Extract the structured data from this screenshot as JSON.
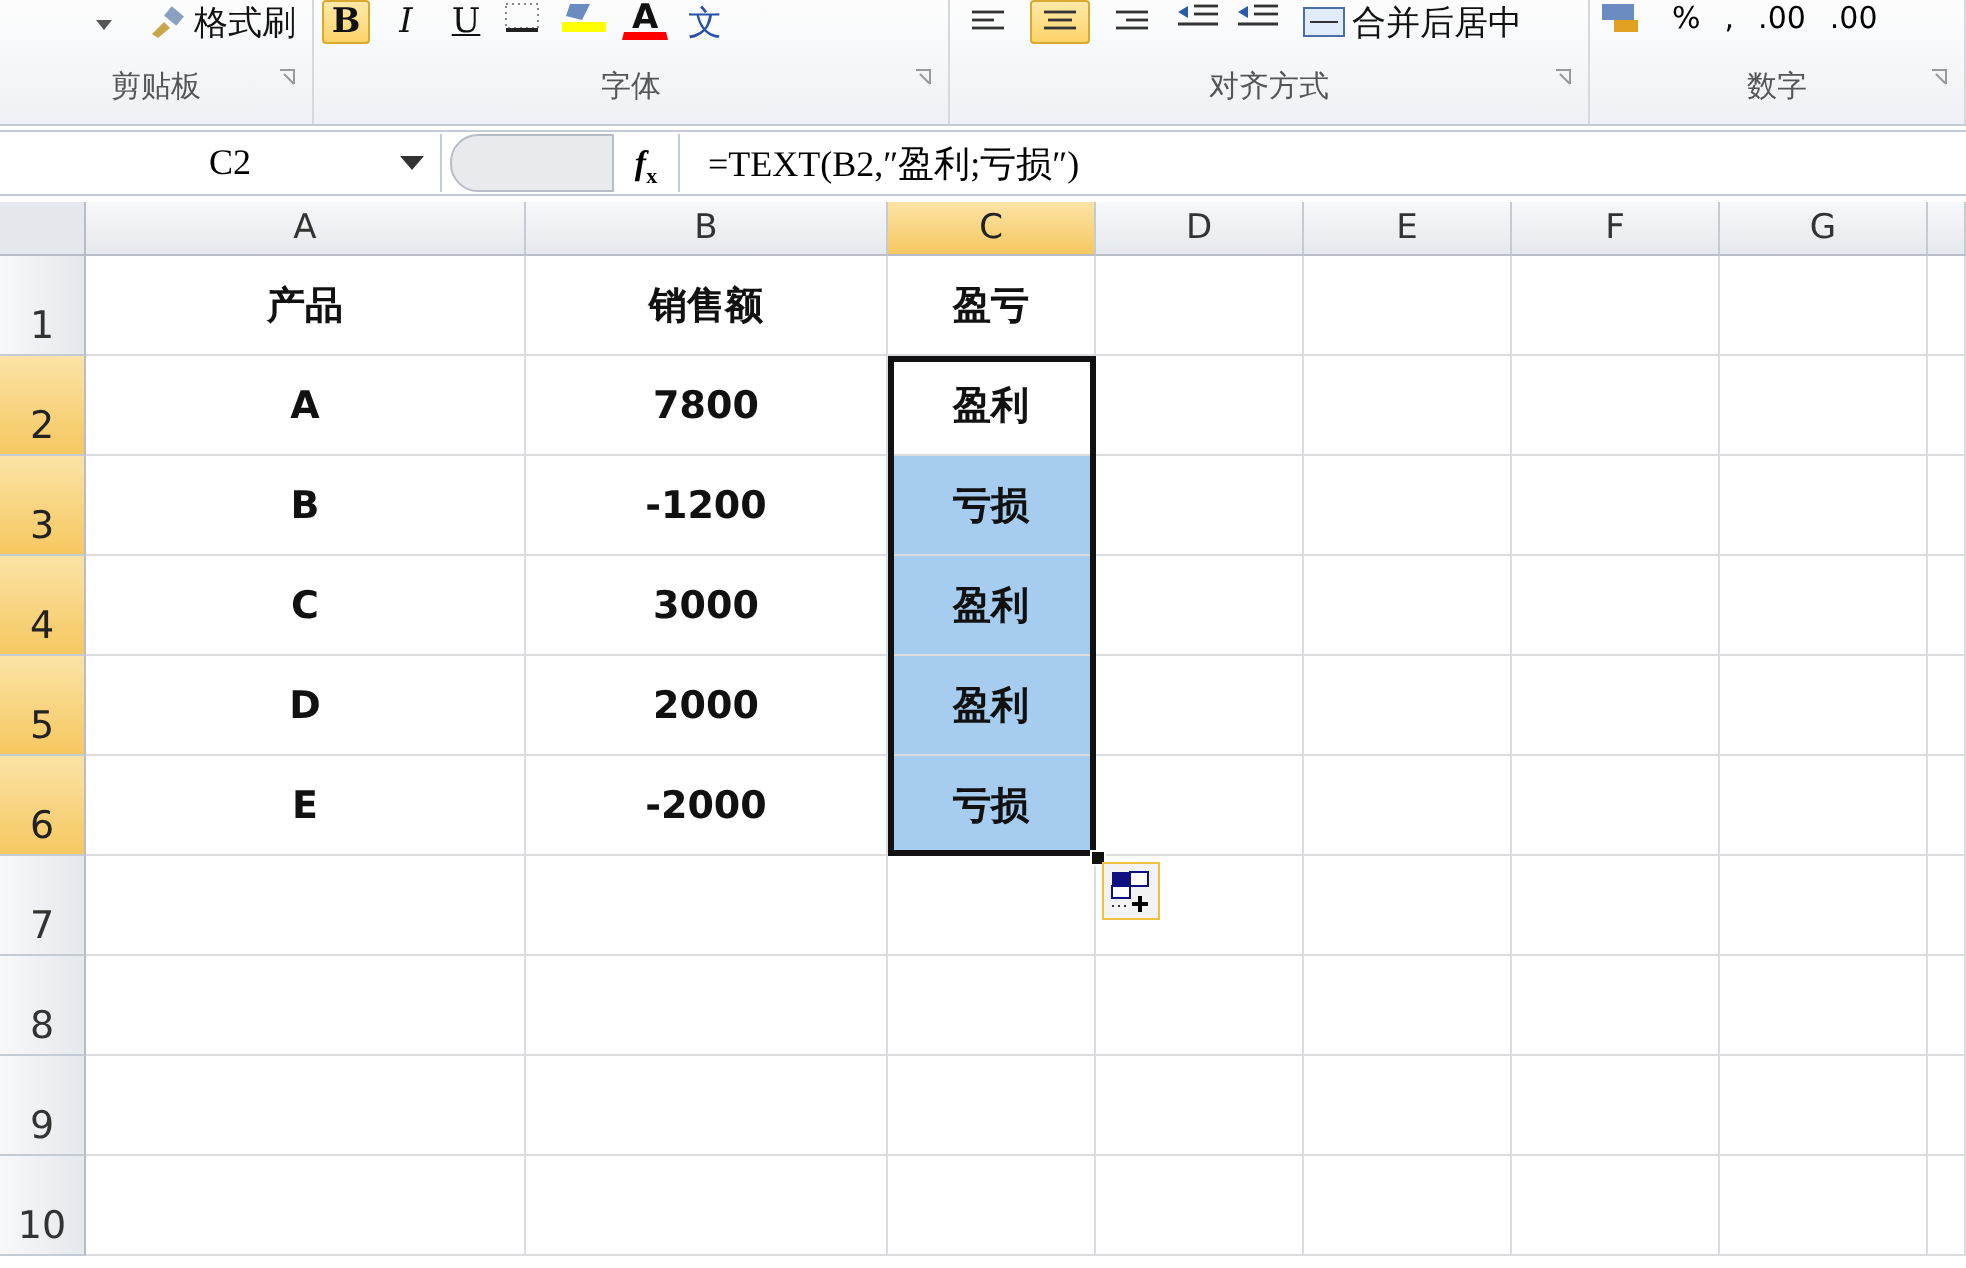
{
  "ribbon": {
    "groups": [
      {
        "label": "剪贴板",
        "items": [
          {
            "kind": "dropdown"
          },
          {
            "kind": "brush",
            "text": "格式刷"
          }
        ]
      },
      {
        "label": "字体",
        "items": [
          {
            "kind": "bold",
            "text": "B",
            "selected": true
          },
          {
            "kind": "italic",
            "text": "I",
            "selected": false
          },
          {
            "kind": "underline",
            "text": "U",
            "selected": false
          },
          {
            "kind": "border"
          },
          {
            "kind": "fill"
          },
          {
            "kind": "fontcolor",
            "text": "A"
          },
          {
            "kind": "phonetic",
            "text": "文"
          }
        ]
      },
      {
        "label": "对齐方式",
        "items": [
          {
            "kind": "alignleft",
            "selected": false
          },
          {
            "kind": "aligncenter",
            "selected": true
          },
          {
            "kind": "alignright",
            "selected": false
          },
          {
            "kind": "outdent"
          },
          {
            "kind": "indent"
          },
          {
            "kind": "merge",
            "text": "合并后居中"
          }
        ]
      },
      {
        "label": "数字",
        "items": [
          {
            "kind": "currency"
          },
          {
            "kind": "plain",
            "text": "%"
          },
          {
            "kind": "plain",
            "text": ","
          },
          {
            "kind": "plain",
            "text": ".00"
          },
          {
            "kind": "plain",
            "text": ".00"
          }
        ]
      }
    ]
  },
  "formula_bar": {
    "name_box": "C2",
    "fx": "*f*$_{x}$",
    "formula": "=TEXT(B2,″盈利;亏损″)"
  },
  "columns": [
    {
      "label": "A",
      "selected": false
    },
    {
      "label": "B",
      "selected": false
    },
    {
      "label": "C",
      "selected": true
    },
    {
      "label": "D",
      "selected": false
    },
    {
      "label": "E",
      "selected": false
    },
    {
      "label": "F",
      "selected": false
    },
    {
      "label": "G",
      "selected": false
    }
  ],
  "rows": [
    {
      "header": "1",
      "selected": false,
      "cells": [
        {
          "text": "产品",
          "selected": false
        },
        {
          "text": "销售额",
          "selected": false
        },
        {
          "text": "盈亏",
          "selected": false
        }
      ]
    },
    {
      "header": "2",
      "selected": true,
      "cells": [
        {
          "text": "A",
          "selected": false
        },
        {
          "text": "7800",
          "selected": false
        },
        {
          "text": "盈利",
          "selected": true,
          "active": true
        }
      ]
    },
    {
      "header": "3",
      "selected": true,
      "cells": [
        {
          "text": "B",
          "selected": false
        },
        {
          "text": "-1200",
          "selected": false
        },
        {
          "text": "亏损",
          "selected": true,
          "active": false
        }
      ]
    },
    {
      "header": "4",
      "selected": true,
      "cells": [
        {
          "text": "C",
          "selected": false
        },
        {
          "text": "3000",
          "selected": false
        },
        {
          "text": "盈利",
          "selected": true,
          "active": false
        }
      ]
    },
    {
      "header": "5",
      "selected": true,
      "cells": [
        {
          "text": "D",
          "selected": false
        },
        {
          "text": "2000",
          "selected": false
        },
        {
          "text": "盈利",
          "selected": true,
          "active": false
        }
      ]
    },
    {
      "header": "6",
      "selected": true,
      "cells": [
        {
          "text": "E",
          "selected": false
        },
        {
          "text": "-2000",
          "selected": false
        },
        {
          "text": "亏损",
          "selected": true,
          "active": false
        }
      ]
    },
    {
      "header": "7",
      "selected": false,
      "cells": []
    },
    {
      "header": "8",
      "selected": false,
      "cells": []
    },
    {
      "header": "9",
      "selected": false,
      "cells": []
    },
    {
      "header": "10",
      "selected": false,
      "cells": []
    }
  ]
}
